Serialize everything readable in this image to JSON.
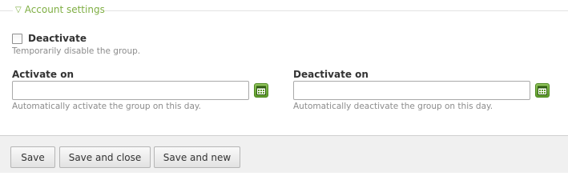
{
  "section": {
    "legend_label": "Account settings",
    "legend_icon": "triangle-down-icon",
    "accent_color": "#7fae43"
  },
  "deactivate": {
    "label": "Deactivate",
    "checked": false,
    "help": "Temporarily disable the group."
  },
  "activate_on": {
    "label": "Activate on",
    "value": "",
    "help": "Automatically activate the group on this day.",
    "icon": "calendar-icon"
  },
  "deactivate_on": {
    "label": "Deactivate on",
    "value": "",
    "help": "Automatically deactivate the group on this day.",
    "icon": "calendar-icon"
  },
  "footer": {
    "save_label": "Save",
    "save_close_label": "Save and close",
    "save_new_label": "Save and new"
  }
}
